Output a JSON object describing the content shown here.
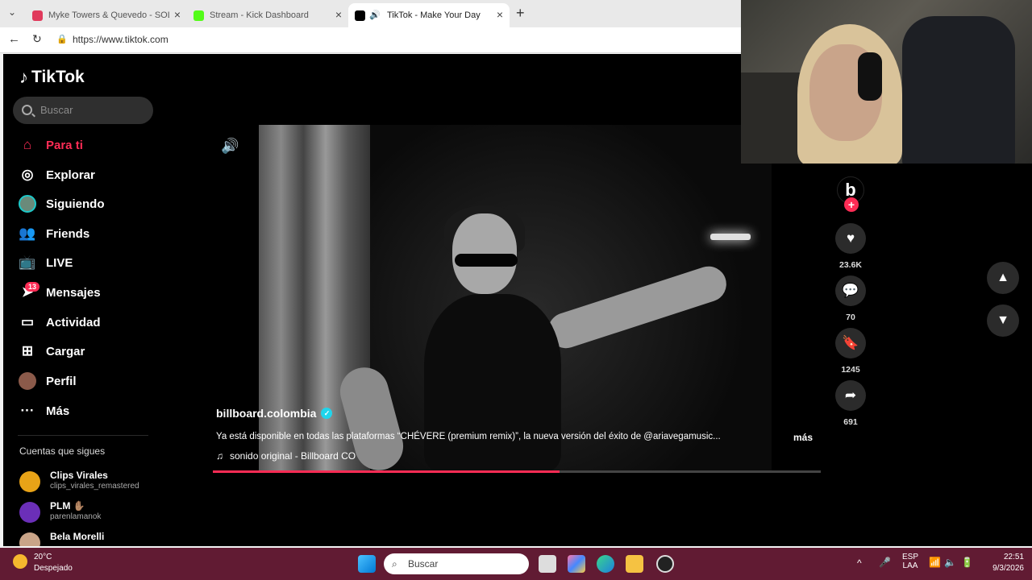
{
  "browser": {
    "tabs": [
      {
        "title": "Myke Towers & Quevedo - SOLEAD",
        "color": "#e03a5c"
      },
      {
        "title": "Stream - Kick Dashboard",
        "color": "#53fc18"
      },
      {
        "title": "TikTok - Make Your Day",
        "color": "#000000"
      }
    ],
    "url": "https://www.tiktok.com"
  },
  "tiktok": {
    "logo": "TikTok",
    "search_placeholder": "Buscar",
    "nav": [
      {
        "label": "Para ti",
        "icon": "home-icon"
      },
      {
        "label": "Explorar",
        "icon": "compass-icon"
      },
      {
        "label": "Siguiendo",
        "icon": "following-icon"
      },
      {
        "label": "Friends",
        "icon": "friends-icon"
      },
      {
        "label": "LIVE",
        "icon": "live-icon"
      },
      {
        "label": "Mensajes",
        "icon": "messages-icon"
      },
      {
        "label": "Actividad",
        "icon": "activity-icon"
      },
      {
        "label": "Cargar",
        "icon": "upload-icon"
      },
      {
        "label": "Perfil",
        "icon": "profile-icon"
      },
      {
        "label": "Más",
        "icon": "more-icon"
      }
    ],
    "messages_badge": "13",
    "following_heading": "Cuentas que sigues",
    "following": [
      {
        "name": "Clips Virales",
        "username": "clips_virales_remastered"
      },
      {
        "name": "PLM ✋🏽",
        "username": "parenlamanok"
      },
      {
        "name": "Bela Morelli",
        "username": ""
      }
    ],
    "video": {
      "username": "billboard.colombia",
      "caption": "Ya está disponible en todas las plataformas “CHÉVERE (premium remix)”, la nueva versión del éxito de @ariavegamusic...",
      "more_label": "más",
      "sound": "sonido original - Billboard CO",
      "progress": 0.57
    },
    "actions": {
      "likes": "23.6K",
      "comments": "70",
      "saves": "1245",
      "shares": "691"
    },
    "colors": {
      "accent": "#fe2c55",
      "verified": "#20d5ec"
    }
  },
  "taskbar": {
    "weather_temp": "20°C",
    "weather_desc": "Despejado",
    "search_placeholder": "Buscar",
    "lang_top": "ESP",
    "lang_bottom": "LAA",
    "time": "22:51",
    "date": "9/3/2026"
  }
}
